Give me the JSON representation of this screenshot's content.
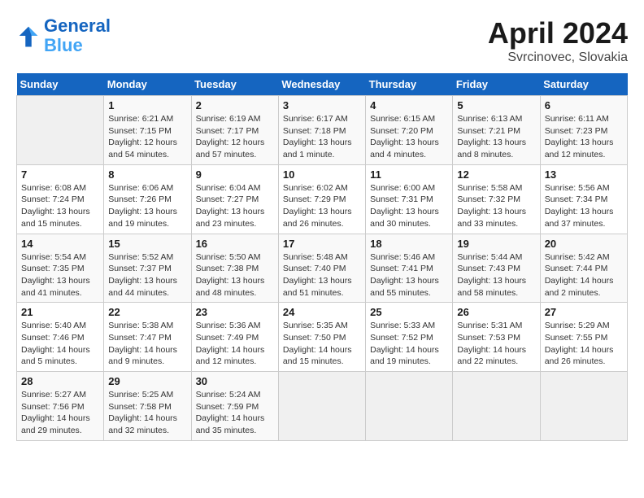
{
  "header": {
    "logo_line1": "General",
    "logo_line2": "Blue",
    "month": "April 2024",
    "location": "Svrcinovec, Slovakia"
  },
  "weekdays": [
    "Sunday",
    "Monday",
    "Tuesday",
    "Wednesday",
    "Thursday",
    "Friday",
    "Saturday"
  ],
  "weeks": [
    [
      {
        "day": "",
        "empty": true
      },
      {
        "day": "1",
        "sunrise": "6:21 AM",
        "sunset": "7:15 PM",
        "daylight": "12 hours and 54 minutes."
      },
      {
        "day": "2",
        "sunrise": "6:19 AM",
        "sunset": "7:17 PM",
        "daylight": "12 hours and 57 minutes."
      },
      {
        "day": "3",
        "sunrise": "6:17 AM",
        "sunset": "7:18 PM",
        "daylight": "13 hours and 1 minute."
      },
      {
        "day": "4",
        "sunrise": "6:15 AM",
        "sunset": "7:20 PM",
        "daylight": "13 hours and 4 minutes."
      },
      {
        "day": "5",
        "sunrise": "6:13 AM",
        "sunset": "7:21 PM",
        "daylight": "13 hours and 8 minutes."
      },
      {
        "day": "6",
        "sunrise": "6:11 AM",
        "sunset": "7:23 PM",
        "daylight": "13 hours and 12 minutes."
      }
    ],
    [
      {
        "day": "7",
        "sunrise": "6:08 AM",
        "sunset": "7:24 PM",
        "daylight": "13 hours and 15 minutes."
      },
      {
        "day": "8",
        "sunrise": "6:06 AM",
        "sunset": "7:26 PM",
        "daylight": "13 hours and 19 minutes."
      },
      {
        "day": "9",
        "sunrise": "6:04 AM",
        "sunset": "7:27 PM",
        "daylight": "13 hours and 23 minutes."
      },
      {
        "day": "10",
        "sunrise": "6:02 AM",
        "sunset": "7:29 PM",
        "daylight": "13 hours and 26 minutes."
      },
      {
        "day": "11",
        "sunrise": "6:00 AM",
        "sunset": "7:31 PM",
        "daylight": "13 hours and 30 minutes."
      },
      {
        "day": "12",
        "sunrise": "5:58 AM",
        "sunset": "7:32 PM",
        "daylight": "13 hours and 33 minutes."
      },
      {
        "day": "13",
        "sunrise": "5:56 AM",
        "sunset": "7:34 PM",
        "daylight": "13 hours and 37 minutes."
      }
    ],
    [
      {
        "day": "14",
        "sunrise": "5:54 AM",
        "sunset": "7:35 PM",
        "daylight": "13 hours and 41 minutes."
      },
      {
        "day": "15",
        "sunrise": "5:52 AM",
        "sunset": "7:37 PM",
        "daylight": "13 hours and 44 minutes."
      },
      {
        "day": "16",
        "sunrise": "5:50 AM",
        "sunset": "7:38 PM",
        "daylight": "13 hours and 48 minutes."
      },
      {
        "day": "17",
        "sunrise": "5:48 AM",
        "sunset": "7:40 PM",
        "daylight": "13 hours and 51 minutes."
      },
      {
        "day": "18",
        "sunrise": "5:46 AM",
        "sunset": "7:41 PM",
        "daylight": "13 hours and 55 minutes."
      },
      {
        "day": "19",
        "sunrise": "5:44 AM",
        "sunset": "7:43 PM",
        "daylight": "13 hours and 58 minutes."
      },
      {
        "day": "20",
        "sunrise": "5:42 AM",
        "sunset": "7:44 PM",
        "daylight": "14 hours and 2 minutes."
      }
    ],
    [
      {
        "day": "21",
        "sunrise": "5:40 AM",
        "sunset": "7:46 PM",
        "daylight": "14 hours and 5 minutes."
      },
      {
        "day": "22",
        "sunrise": "5:38 AM",
        "sunset": "7:47 PM",
        "daylight": "14 hours and 9 minutes."
      },
      {
        "day": "23",
        "sunrise": "5:36 AM",
        "sunset": "7:49 PM",
        "daylight": "14 hours and 12 minutes."
      },
      {
        "day": "24",
        "sunrise": "5:35 AM",
        "sunset": "7:50 PM",
        "daylight": "14 hours and 15 minutes."
      },
      {
        "day": "25",
        "sunrise": "5:33 AM",
        "sunset": "7:52 PM",
        "daylight": "14 hours and 19 minutes."
      },
      {
        "day": "26",
        "sunrise": "5:31 AM",
        "sunset": "7:53 PM",
        "daylight": "14 hours and 22 minutes."
      },
      {
        "day": "27",
        "sunrise": "5:29 AM",
        "sunset": "7:55 PM",
        "daylight": "14 hours and 26 minutes."
      }
    ],
    [
      {
        "day": "28",
        "sunrise": "5:27 AM",
        "sunset": "7:56 PM",
        "daylight": "14 hours and 29 minutes."
      },
      {
        "day": "29",
        "sunrise": "5:25 AM",
        "sunset": "7:58 PM",
        "daylight": "14 hours and 32 minutes."
      },
      {
        "day": "30",
        "sunrise": "5:24 AM",
        "sunset": "7:59 PM",
        "daylight": "14 hours and 35 minutes."
      },
      {
        "day": "",
        "empty": true
      },
      {
        "day": "",
        "empty": true
      },
      {
        "day": "",
        "empty": true
      },
      {
        "day": "",
        "empty": true
      }
    ]
  ]
}
